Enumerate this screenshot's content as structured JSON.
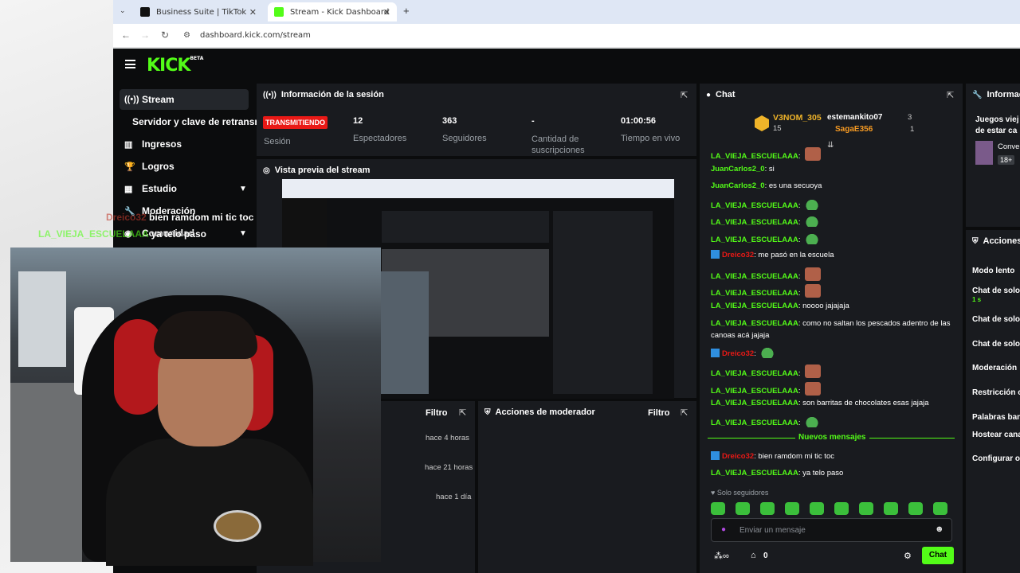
{
  "browser": {
    "tabs": [
      {
        "title": "Business Suite | TikTok"
      },
      {
        "title": "Stream - Kick Dashboard"
      }
    ],
    "url": "dashboard.kick.com/stream",
    "new_tab": "+"
  },
  "app": {
    "logo": "KICK",
    "logo_badge": "BETA"
  },
  "sidebar": {
    "items": [
      {
        "label": "Stream"
      },
      {
        "label": "Servidor y clave de retransmisión"
      },
      {
        "label": "Ingresos"
      },
      {
        "label": "Logros"
      },
      {
        "label": "Estudio"
      },
      {
        "label": "Moderación"
      },
      {
        "label": "Comunidad"
      }
    ]
  },
  "session": {
    "title": "Información de la sesión",
    "status": "TRANSMITIENDO",
    "status_label": "Sesión",
    "stats": [
      {
        "value": "12",
        "label": "Espectadores"
      },
      {
        "value": "363",
        "label": "Seguidores"
      },
      {
        "value": "-",
        "label": "Cantidad de suscripciones"
      },
      {
        "value": "01:00:56",
        "label": "Tiempo en vivo"
      }
    ]
  },
  "preview": {
    "title": "Vista previa del stream"
  },
  "activity": {
    "filter": "Filtro",
    "times": [
      "hace 4 horas",
      "hace 21 horas",
      "hace 1 día"
    ]
  },
  "mod_actions_panel": {
    "title": "Acciones de moderador",
    "filter": "Filtro"
  },
  "chat": {
    "title": "Chat",
    "leaders": {
      "top": {
        "name": "V3NOM_305",
        "count": "15"
      },
      "second": {
        "name": "estemankito07",
        "count": "3"
      },
      "third": {
        "name": "SagaE356",
        "count": "1"
      }
    },
    "messages": [
      {
        "user": "LA_VIEJA_ESCUELAAA",
        "text": ""
      },
      {
        "user": "JuanCarlos2_0",
        "text": "si"
      },
      {
        "user": "JuanCarlos2_0",
        "text": "es una secuoya"
      },
      {
        "user": "LA_VIEJA_ESCUELAAA",
        "text": ""
      },
      {
        "user": "LA_VIEJA_ESCUELAAA",
        "text": ""
      },
      {
        "user": "LA_VIEJA_ESCUELAAA",
        "text": ""
      },
      {
        "user": "Dreico32",
        "text": "me pasó en la escuela"
      },
      {
        "user": "LA_VIEJA_ESCUELAAA",
        "text": ""
      },
      {
        "user": "LA_VIEJA_ESCUELAAA",
        "text": ""
      },
      {
        "user": "LA_VIEJA_ESCUELAAA",
        "text": "noooo jajajaja"
      },
      {
        "user": "LA_VIEJA_ESCUELAAA",
        "text": "como no saltan los pescados adentro de las"
      },
      {
        "user": "",
        "text": "canoas acá jajaja"
      },
      {
        "user": "Dreico32",
        "text": ""
      },
      {
        "user": "LA_VIEJA_ESCUELAAA",
        "text": ""
      },
      {
        "user": "LA_VIEJA_ESCUELAAA",
        "text": ""
      },
      {
        "user": "LA_VIEJA_ESCUELAAA",
        "text": "son barritas de chocolates esas jajaja"
      },
      {
        "user": "LA_VIEJA_ESCUELAAA",
        "text": ""
      }
    ],
    "divider": "Nuevos mensajes",
    "new_messages": [
      {
        "user": "Dreico32",
        "text": "bien ramdom mi tic toc"
      },
      {
        "user": "LA_VIEJA_ESCUELAAA",
        "text": "ya telo paso"
      }
    ],
    "followers_only": "Solo seguidores",
    "input_placeholder": "Enviar un mensaje",
    "footer_count": "0",
    "send": "Chat"
  },
  "info_panel": {
    "title": "Información",
    "text1": "Juegos viej",
    "text2": "de estar ca",
    "item": "Conve",
    "badge": "18+"
  },
  "actions_panel": {
    "title": "Acciones",
    "items": [
      {
        "label": "Modo lento"
      },
      {
        "label": "Chat de solo",
        "sub": "1 s"
      },
      {
        "label": "Chat de solo"
      },
      {
        "label": "Chat de solo"
      },
      {
        "label": "Moderación"
      },
      {
        "label": "Restricción c"
      },
      {
        "label": "Palabras ban"
      },
      {
        "label": "Hostear cana"
      },
      {
        "label": "Configurar o"
      }
    ]
  },
  "overlay": {
    "line1_user": "Dreico32",
    "line1_text": "bien ramdom mi tic toc",
    "line2_user": "LA_VIEJA_ESCUELAAA",
    "line2_text": "ya telo paso"
  },
  "colors": {
    "accent": "#53fc18",
    "live": "#e91916",
    "panel": "#191b1f",
    "bg": "#0b0c0d"
  }
}
